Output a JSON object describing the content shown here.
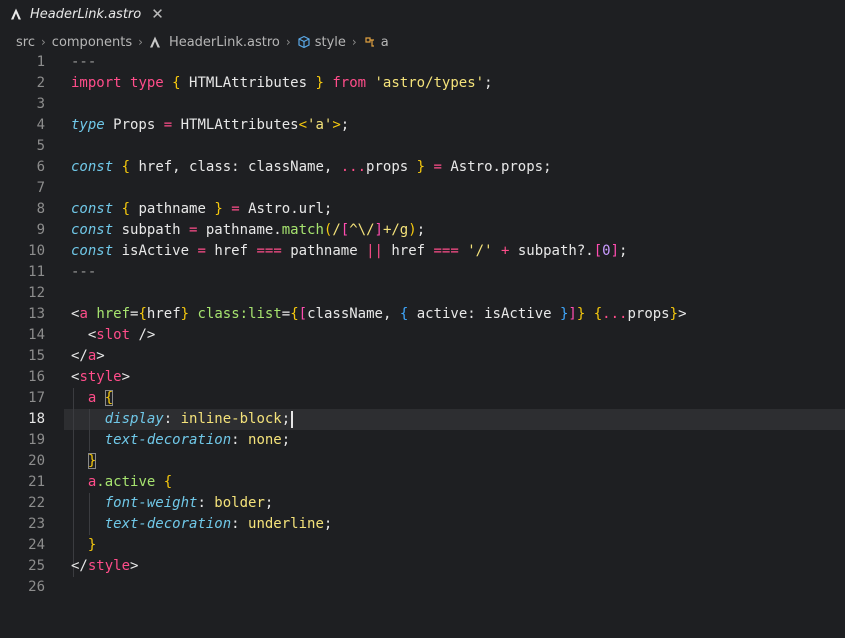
{
  "tab": {
    "title": "HeaderLink.astro",
    "close": "✕"
  },
  "breadcrumb": {
    "src": "src",
    "components": "components",
    "file": "HeaderLink.astro",
    "style": "style",
    "a": "a"
  },
  "colors": {
    "background": "#1e1f22",
    "keyword": "#ff4d8a",
    "string": "#f4e27a",
    "type": "#70c8e8",
    "function": "#a6e36f"
  },
  "line_numbers": [
    "1",
    "2",
    "3",
    "4",
    "5",
    "6",
    "7",
    "8",
    "9",
    "10",
    "11",
    "12",
    "13",
    "14",
    "15",
    "16",
    "17",
    "18",
    "19",
    "20",
    "21",
    "22",
    "23",
    "24",
    "25",
    "26"
  ],
  "code": {
    "l1": "---",
    "l2_import": "import",
    "l2_type": "type",
    "l2_ob": "{",
    "l2_name": " HTMLAttributes ",
    "l2_cb": "}",
    "l2_from": "from",
    "l2_str": "'astro/types'",
    "l2_semi": ";",
    "l4_type": "type",
    "l4_a": " Props ",
    "l4_eq": "=",
    "l4_b": " HTMLAttributes",
    "l4_lt": "<",
    "l4_str": "'a'",
    "l4_gt": ">",
    "l4_semi": ";",
    "l6_const": "const",
    "l6_ob": "{",
    "l6_a": " href, class: className, ",
    "l6_spread": "...",
    "l6_b": "props ",
    "l6_cb": "}",
    "l6_eq": "=",
    "l6_c": " Astro.props;",
    "l8_const": "const",
    "l8_ob": "{",
    "l8_a": " pathname ",
    "l8_cb": "}",
    "l8_eq": "=",
    "l8_b": " Astro.url;",
    "l9_const": "const",
    "l9_a": " subpath ",
    "l9_eq": "=",
    "l9_b": " pathname.",
    "l9_fn": "match",
    "l9_op": "(",
    "l9_rx1": "/",
    "l9_rx2": "[",
    "l9_rx3": "^\\/",
    "l9_rx4": "]",
    "l9_rx5": "+/g",
    "l9_cp": ")",
    "l9_semi": ";",
    "l10_const": "const",
    "l10_a": " isActive ",
    "l10_eq": "=",
    "l10_b": " href ",
    "l10_eqq": "===",
    "l10_c": " pathname ",
    "l10_or": "||",
    "l10_d": " href ",
    "l10_eqq2": "===",
    "l10_str": "'/'",
    "l10_plus": "+",
    "l10_e": " subpath?.",
    "l10_ob": "[",
    "l10_num": "0",
    "l10_cb": "]",
    "l10_semi": ";",
    "l11": "---",
    "l13_lt": "<",
    "l13_tag": "a",
    "l13_href": "href",
    "l13_eq": "=",
    "l13_ob": "{",
    "l13_hv": "href",
    "l13_cb": "}",
    "l13_class": "class:list",
    "l13_eq2": "=",
    "l13_ob2": "{",
    "l13_ob3": "[",
    "l13_cn": "className, ",
    "l13_ob4": "{",
    "l13_act": " active: isActive ",
    "l13_cb4": "}",
    "l13_cb3": "]",
    "l13_cb2": "}",
    "l13_ob5": "{",
    "l13_spread": "...",
    "l13_props": "props",
    "l13_cb5": "}",
    "l13_gt": ">",
    "l14_lt": "<",
    "l14_tag": "slot",
    "l14_end": " />",
    "l15_lt": "</",
    "l15_tag": "a",
    "l15_gt": ">",
    "l16_lt": "<",
    "l16_tag": "style",
    "l16_gt": ">",
    "l17_sel": "a",
    "l17_ob": "{",
    "l18_prop": "display",
    "l18_colon": ": ",
    "l18_val": "inline-block",
    "l18_semi": ";",
    "l19_prop": "text-decoration",
    "l19_colon": ": ",
    "l19_val": "none",
    "l19_semi": ";",
    "l20_cb": "}",
    "l21_sel": "a",
    "l21_cls": ".active",
    "l21_ob": "{",
    "l22_prop": "font-weight",
    "l22_colon": ": ",
    "l22_val": "bolder",
    "l22_semi": ";",
    "l23_prop": "text-decoration",
    "l23_colon": ": ",
    "l23_val": "underline",
    "l23_semi": ";",
    "l24_cb": "}",
    "l25_lt": "</",
    "l25_tag": "style",
    "l25_gt": ">"
  }
}
